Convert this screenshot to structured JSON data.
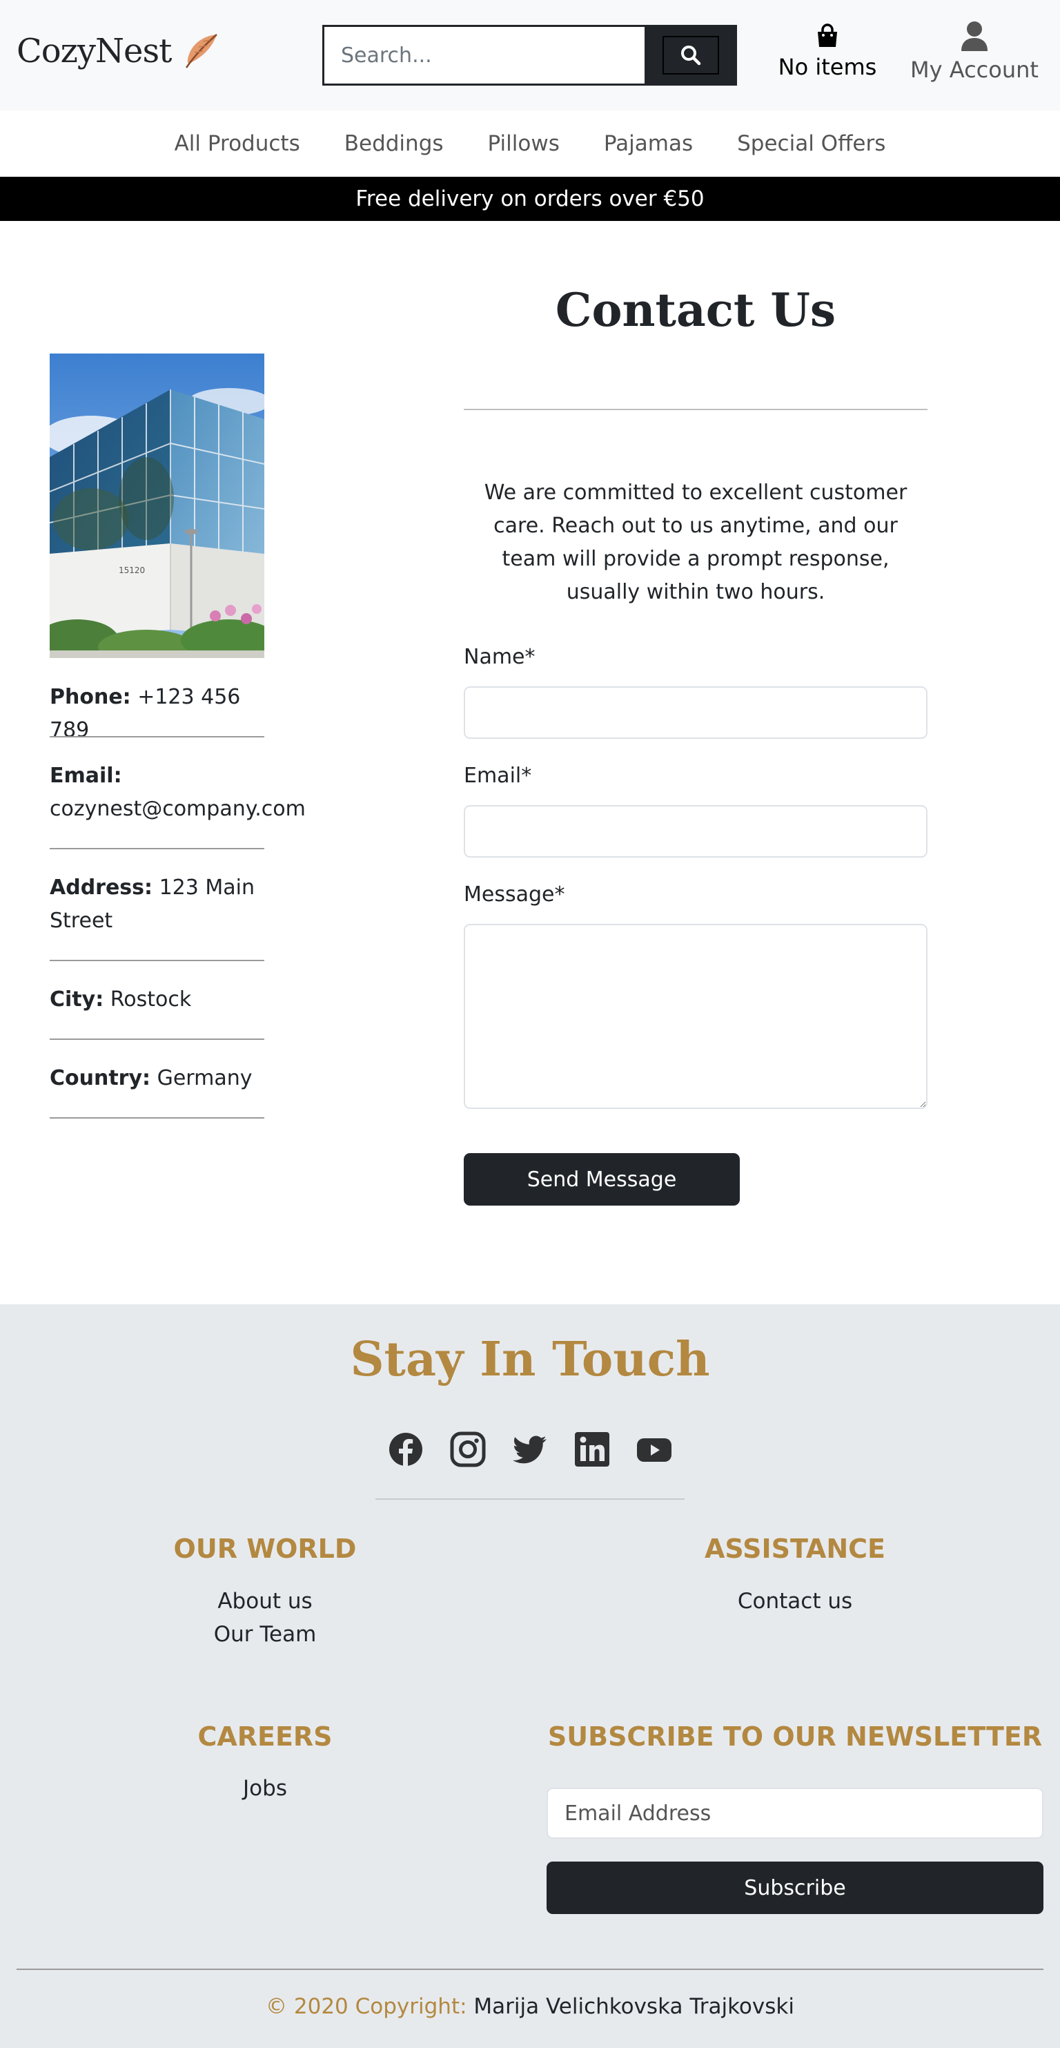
{
  "header": {
    "brand": "CozyNest",
    "search_placeholder": "Search...",
    "cart_label": "No items",
    "account_label": "My Account"
  },
  "nav": {
    "items": [
      {
        "label": "All Products"
      },
      {
        "label": "Beddings"
      },
      {
        "label": "Pillows"
      },
      {
        "label": "Pajamas"
      },
      {
        "label": "Special Offers"
      }
    ]
  },
  "promo": {
    "text": "Free delivery on orders over €50"
  },
  "contact_info": {
    "phone_label": "Phone:",
    "phone_value": "+123 456 789",
    "email_label": "Email:",
    "email_value": "cozynest@company.com",
    "address_label": "Address:",
    "address_value": "123 Main Street",
    "city_label": "City:",
    "city_value": "Rostock",
    "country_label": "Country:",
    "country_value": "Germany",
    "building_number": "15120"
  },
  "contact_form": {
    "title": "Contact Us",
    "intro": "We are committed to excellent customer care. Reach out to us anytime, and our team will provide a prompt response, usually within two hours.",
    "name_label": "Name*",
    "name_value": "",
    "email_label": "Email*",
    "email_value": "",
    "message_label": "Message*",
    "message_value": "",
    "submit_label": "Send Message"
  },
  "footer": {
    "stay_title": "Stay In Touch",
    "social_icons": [
      "facebook-icon",
      "instagram-icon",
      "twitter-icon",
      "linkedin-icon",
      "youtube-icon"
    ],
    "our_world_title": "OUR WORLD",
    "our_world_links": [
      "About us",
      "Our Team"
    ],
    "assistance_title": "ASSISTANCE",
    "assistance_links": [
      "Contact us"
    ],
    "careers_title": "CAREERS",
    "careers_links": [
      "Jobs"
    ],
    "newsletter_title": "SUBSCRIBE TO OUR NEWSLETTER",
    "newsletter_placeholder": "Email Address",
    "subscribe_label": "Subscribe",
    "copyright_prefix": "© 2020 Copyright:",
    "copyright_name": "Marija Velichkovska Trajkovski"
  },
  "colors": {
    "dark": "#212529",
    "accent_gold": "#b38840",
    "footer_bg": "#e7eaed",
    "header_bg": "#f8f9fa",
    "promo_bg": "#000000"
  }
}
